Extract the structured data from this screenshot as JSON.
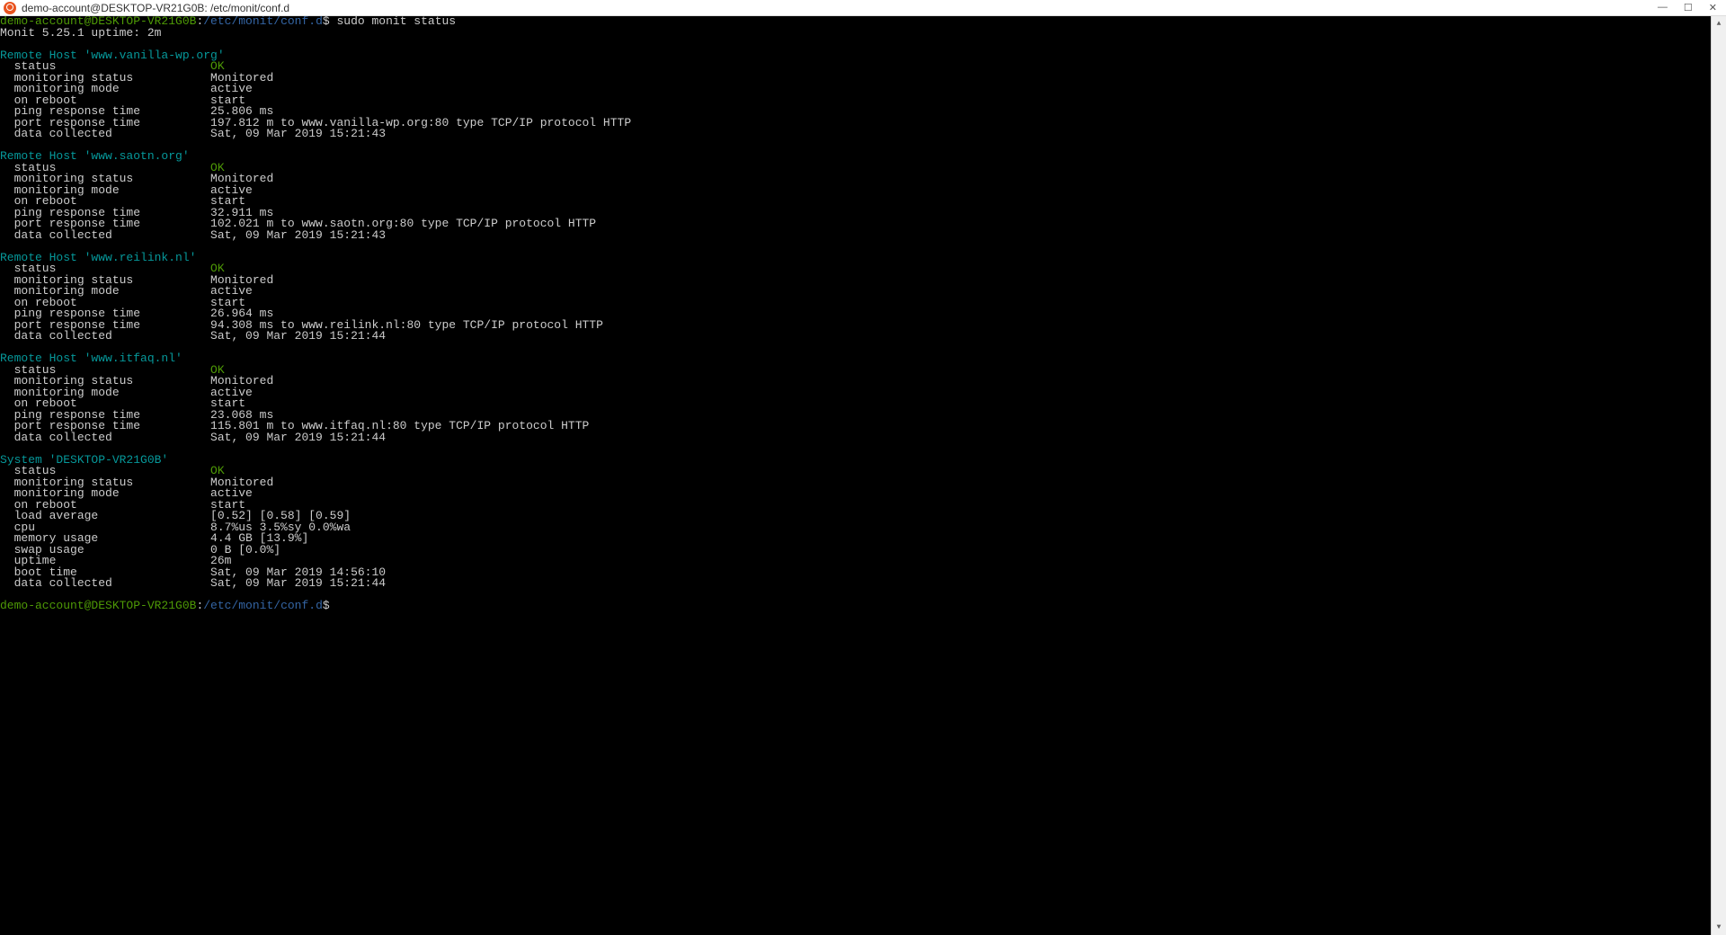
{
  "window": {
    "title": "demo-account@DESKTOP-VR21G0B: /etc/monit/conf.d"
  },
  "prompt": {
    "user_host": "demo-account@DESKTOP-VR21G0B",
    "colon": ":",
    "path": "/etc/monit/conf.d",
    "dollar": "$",
    "command": "sudo monit status"
  },
  "header_line": "Monit 5.25.1 uptime: 2m",
  "labels": {
    "status": "status",
    "monitoring_status": "monitoring status",
    "monitoring_mode": "monitoring mode",
    "on_reboot": "on reboot",
    "ping_response_time": "ping response time",
    "port_response_time": "port response time",
    "data_collected": "data collected",
    "load_average": "load average",
    "cpu": "cpu",
    "memory_usage": "memory usage",
    "swap_usage": "swap usage",
    "uptime": "uptime",
    "boot_time": "boot time"
  },
  "hosts": [
    {
      "title": "Remote Host 'www.vanilla-wp.org'",
      "status": "OK",
      "monitoring_status": "Monitored",
      "monitoring_mode": "active",
      "on_reboot": "start",
      "ping_response_time": "25.806 ms",
      "port_response_time": "197.812 m to www.vanilla-wp.org:80 type TCP/IP protocol HTTP",
      "data_collected": "Sat, 09 Mar 2019 15:21:43"
    },
    {
      "title": "Remote Host 'www.saotn.org'",
      "status": "OK",
      "monitoring_status": "Monitored",
      "monitoring_mode": "active",
      "on_reboot": "start",
      "ping_response_time": "32.911 ms",
      "port_response_time": "102.021 m to www.saotn.org:80 type TCP/IP protocol HTTP",
      "data_collected": "Sat, 09 Mar 2019 15:21:43"
    },
    {
      "title": "Remote Host 'www.reilink.nl'",
      "status": "OK",
      "monitoring_status": "Monitored",
      "monitoring_mode": "active",
      "on_reboot": "start",
      "ping_response_time": "26.964 ms",
      "port_response_time": "94.308 ms to www.reilink.nl:80 type TCP/IP protocol HTTP",
      "data_collected": "Sat, 09 Mar 2019 15:21:44"
    },
    {
      "title": "Remote Host 'www.itfaq.nl'",
      "status": "OK",
      "monitoring_status": "Monitored",
      "monitoring_mode": "active",
      "on_reboot": "start",
      "ping_response_time": "23.068 ms",
      "port_response_time": "115.801 m to www.itfaq.nl:80 type TCP/IP protocol HTTP",
      "data_collected": "Sat, 09 Mar 2019 15:21:44"
    }
  ],
  "system": {
    "title": "System 'DESKTOP-VR21G0B'",
    "status": "OK",
    "monitoring_status": "Monitored",
    "monitoring_mode": "active",
    "on_reboot": "start",
    "load_average": "[0.52] [0.58] [0.59]",
    "cpu": "8.7%us 3.5%sy 0.0%wa",
    "memory_usage": "4.4 GB [13.9%]",
    "swap_usage": "0 B [0.0%]",
    "uptime": "26m",
    "boot_time": "Sat, 09 Mar 2019 14:56:10",
    "data_collected": "Sat, 09 Mar 2019 15:21:44"
  }
}
